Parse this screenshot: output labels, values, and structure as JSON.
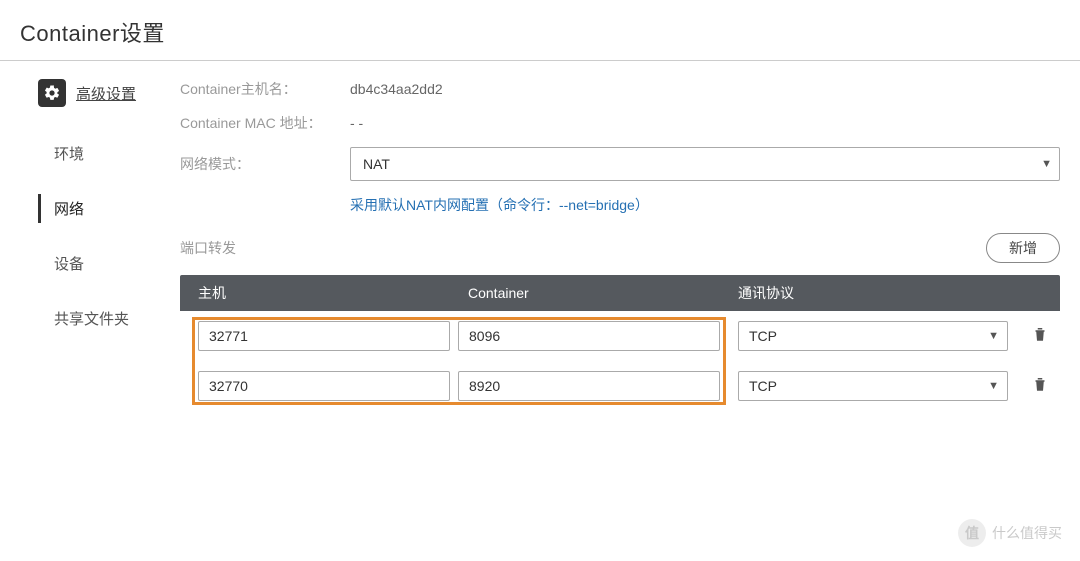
{
  "page_title": "Container设置",
  "advanced_label": "高级设置",
  "sidebar": {
    "items": [
      {
        "label": "环境",
        "active": false
      },
      {
        "label": "网络",
        "active": true
      },
      {
        "label": "设备",
        "active": false
      },
      {
        "label": "共享文件夹",
        "active": false
      }
    ]
  },
  "form": {
    "hostname_label": "Container主机名：",
    "hostname_value": "db4c34aa2dd2",
    "mac_label": "Container MAC 地址：",
    "mac_value": "- -",
    "netmode_label": "网络模式：",
    "netmode_value": "NAT",
    "nat_note": "采用默认NAT内网配置（命令行：--net=bridge）"
  },
  "port_forward": {
    "section_label": "端口转发",
    "add_button": "新增",
    "columns": {
      "host": "主机",
      "container": "Container",
      "protocol": "通讯协议"
    },
    "rows": [
      {
        "host": "32771",
        "container": "8096",
        "protocol": "TCP"
      },
      {
        "host": "32770",
        "container": "8920",
        "protocol": "TCP"
      }
    ]
  },
  "watermark": {
    "left": "值",
    "right": "什么值得买"
  }
}
